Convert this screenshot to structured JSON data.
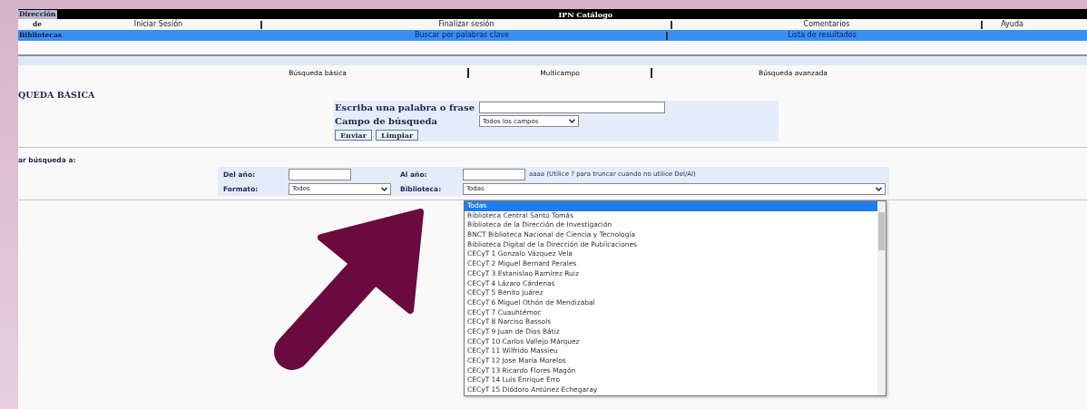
{
  "header": {
    "title": "IPN Catálogo",
    "org_lines": [
      "Dirección",
      "de",
      "Bibliotecas"
    ]
  },
  "top_nav": [
    {
      "label": "Iniciar Sesión"
    },
    {
      "label": "Finalizar sesión"
    },
    {
      "label": "Comentarios"
    },
    {
      "label": "Ayuda"
    }
  ],
  "sub_nav": [
    {
      "label": "Buscar por palabras clave"
    },
    {
      "label": "Lista de resultados"
    }
  ],
  "search_tabs": [
    {
      "label": "Búsqueda básica"
    },
    {
      "label": "Multicampo"
    },
    {
      "label": "Búsqueda avanzada"
    }
  ],
  "heading": "QUEDA BÁSICA",
  "form": {
    "phrase_label": "Escriba una palabra o frase",
    "field_label": "Campo de búsqueda",
    "field_value": "Todos los campos",
    "buttons": [
      "Enviar",
      "Limpiar"
    ]
  },
  "limit_label": "ar búsqueda a:",
  "limits": {
    "from_label": "Del año:",
    "to_label": "Al año:",
    "hint": "aaaa (Utilice ? para truncar cuando no utilice Del/Al)",
    "format_label": "Formato:",
    "format_value": "Todos",
    "library_label": "Biblioteca:",
    "library_value": "Todas"
  },
  "library_options": [
    {
      "label": "Todas",
      "selected": true
    },
    {
      "label": "Biblioteca Central Santo Tomás",
      "selected": false
    },
    {
      "label": "Biblioteca de la Dirección de Investigación",
      "selected": false
    },
    {
      "label": "BNCT Biblioteca Nacional de Ciencia y Tecnología",
      "selected": false
    },
    {
      "label": "Biblioteca Digital de la Dirección de Publicaciones",
      "selected": false
    },
    {
      "label": "CECyT 1 Gonzalo Vázquez Vela",
      "selected": false
    },
    {
      "label": "CECyT 2 Miguel Bernard Perales",
      "selected": false
    },
    {
      "label": "CECyT 3 Estanislao Ramírez Ruiz",
      "selected": false
    },
    {
      "label": "CECyT 4 Lázaro Cárdenas",
      "selected": false
    },
    {
      "label": "CECyT 5 Benito Juárez",
      "selected": false
    },
    {
      "label": "CECyT 6 Miguel Othón de Mendizabal",
      "selected": false
    },
    {
      "label": "CECyT 7 Cuauhtémoc",
      "selected": false
    },
    {
      "label": "CECyT 8 Narciso Bassols",
      "selected": false
    },
    {
      "label": "CECyT 9 Juan de Dios Bátiz",
      "selected": false
    },
    {
      "label": "CECyT 10 Carlos Vallejo Márquez",
      "selected": false
    },
    {
      "label": "CECyT 11 Wilfrido Massieu",
      "selected": false
    },
    {
      "label": "CECyT 12 Jose María Morelos",
      "selected": false
    },
    {
      "label": "CECyT 13 Ricardo Flores Magón",
      "selected": false
    },
    {
      "label": "CECyT 14 Luis Enrique Erro",
      "selected": false
    },
    {
      "label": "CECyT 15 Diódoro Antúnez Echegaray",
      "selected": false
    }
  ]
}
